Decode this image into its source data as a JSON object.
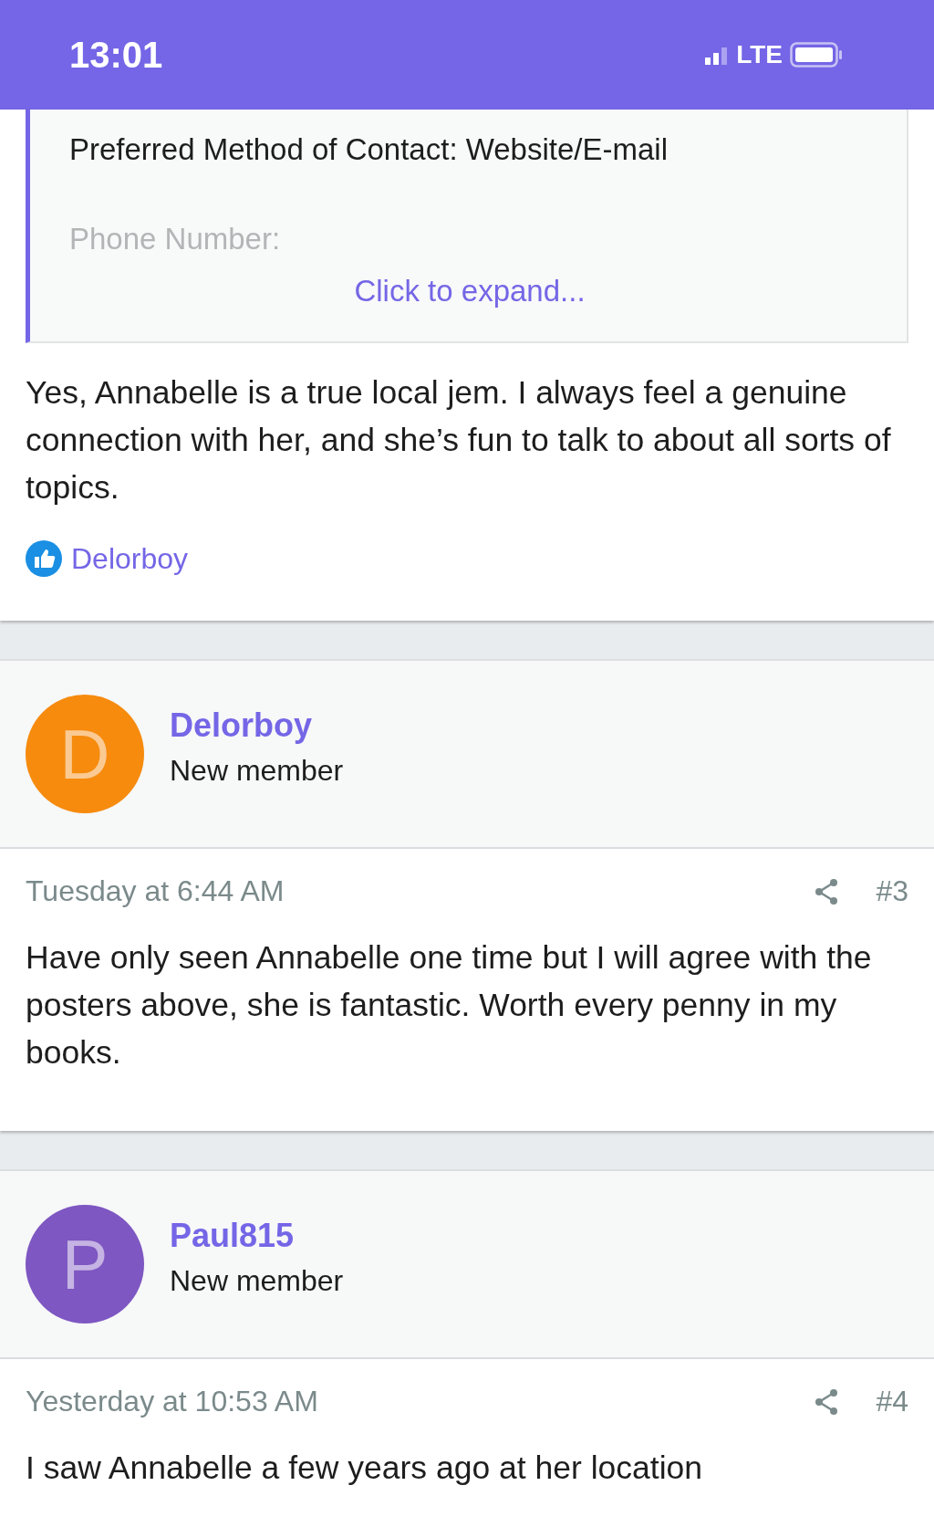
{
  "status_bar": {
    "time": "13:01",
    "network": "LTE"
  },
  "quote": {
    "lines": [
      "Preferred Method of Contact: Website/E-mail",
      "Phone Number:"
    ],
    "expand": "Click to expand..."
  },
  "first_post": {
    "body": "Yes, Annabelle is a true local jem. I always feel a genuine connection with her, and she’s fun to talk to about all sorts of topics.",
    "likes": "Delorboy"
  },
  "posts": [
    {
      "author": "Delorboy",
      "initial": "D",
      "color": "#f68b0e",
      "role": "New member",
      "date": "Tuesday at 6:44 AM",
      "number": "#3",
      "body": "Have only seen Annabelle one time but I will agree with the posters above, she is fantastic. Worth every penny in my books."
    },
    {
      "author": "Paul815",
      "initial": "P",
      "color": "#7e57c2",
      "role": "New member",
      "date": "Yesterday at 10:53 AM",
      "number": "#4",
      "body": "I saw Annabelle a few years ago at her location"
    }
  ]
}
